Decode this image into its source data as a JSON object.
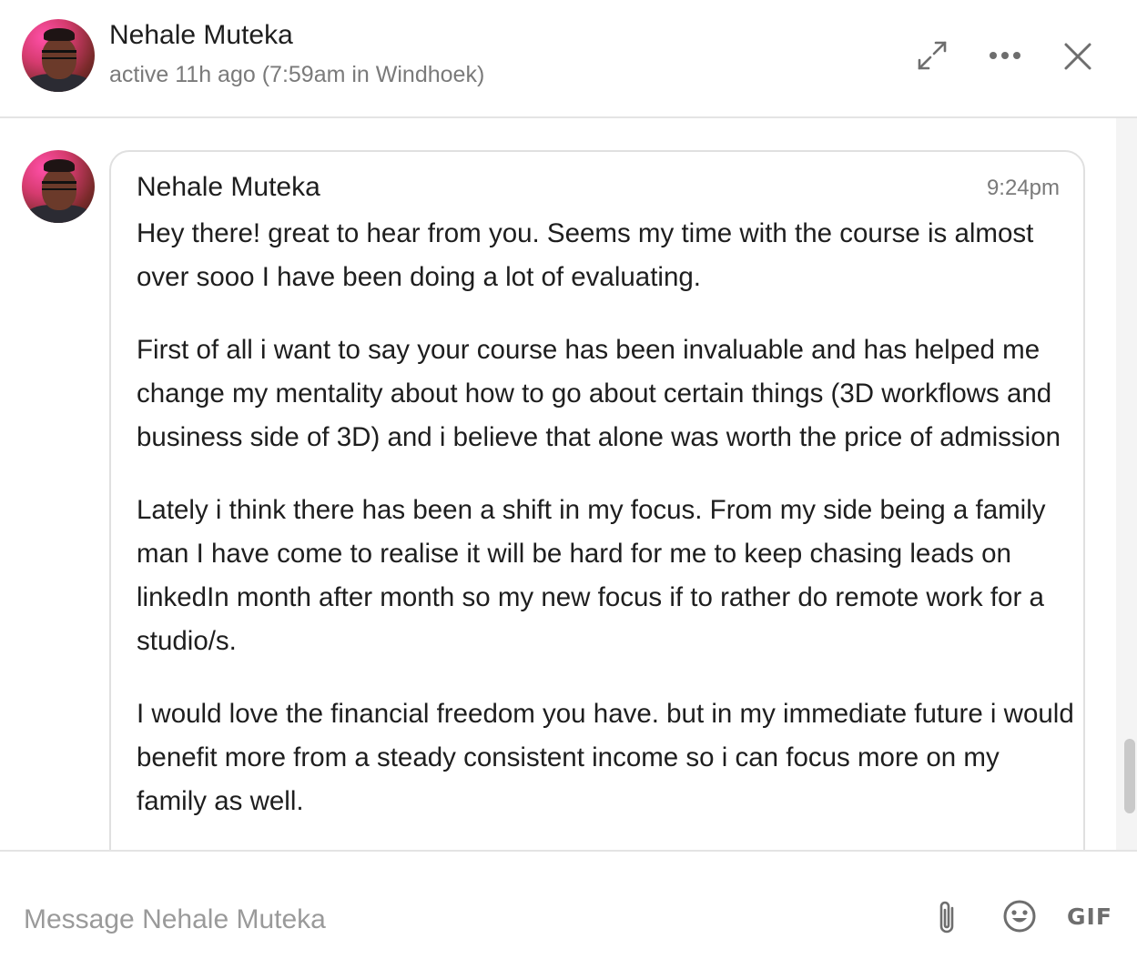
{
  "header": {
    "name": "Nehale Muteka",
    "status": "active 11h ago (7:59am in Windhoek)",
    "icons": [
      "expand-icon",
      "more-icon",
      "close-icon"
    ]
  },
  "message": {
    "sender": "Nehale Muteka",
    "time": "9:24pm",
    "paragraphs": [
      "Hey there! great to hear from you. Seems my time with the course is almost over sooo I have been doing a lot of evaluating.",
      "First of all i want to say your course has been invaluable and has helped me change my mentality about how to go about certain things (3D workflows and business side of 3D) and i believe that alone was worth the price of admission",
      "Lately i think there has been a shift in my focus. From my side being a family man I have come to realise it will be hard for me to keep chasing leads on linkedIn month after month so my new focus if to rather do remote work for a studio/s.",
      "I would love the financial freedom you have. but in my immediate future i would benefit more from a steady consistent income so i can focus more on my family as well."
    ]
  },
  "composer": {
    "placeholder": "Message Nehale Muteka",
    "value": "",
    "gif_label": "GIF",
    "icons": [
      "attachment-icon",
      "emoji-icon"
    ]
  },
  "colors": {
    "text": "#1e1e1e",
    "muted": "#7a7a7a",
    "border": "#e0e0e0"
  }
}
